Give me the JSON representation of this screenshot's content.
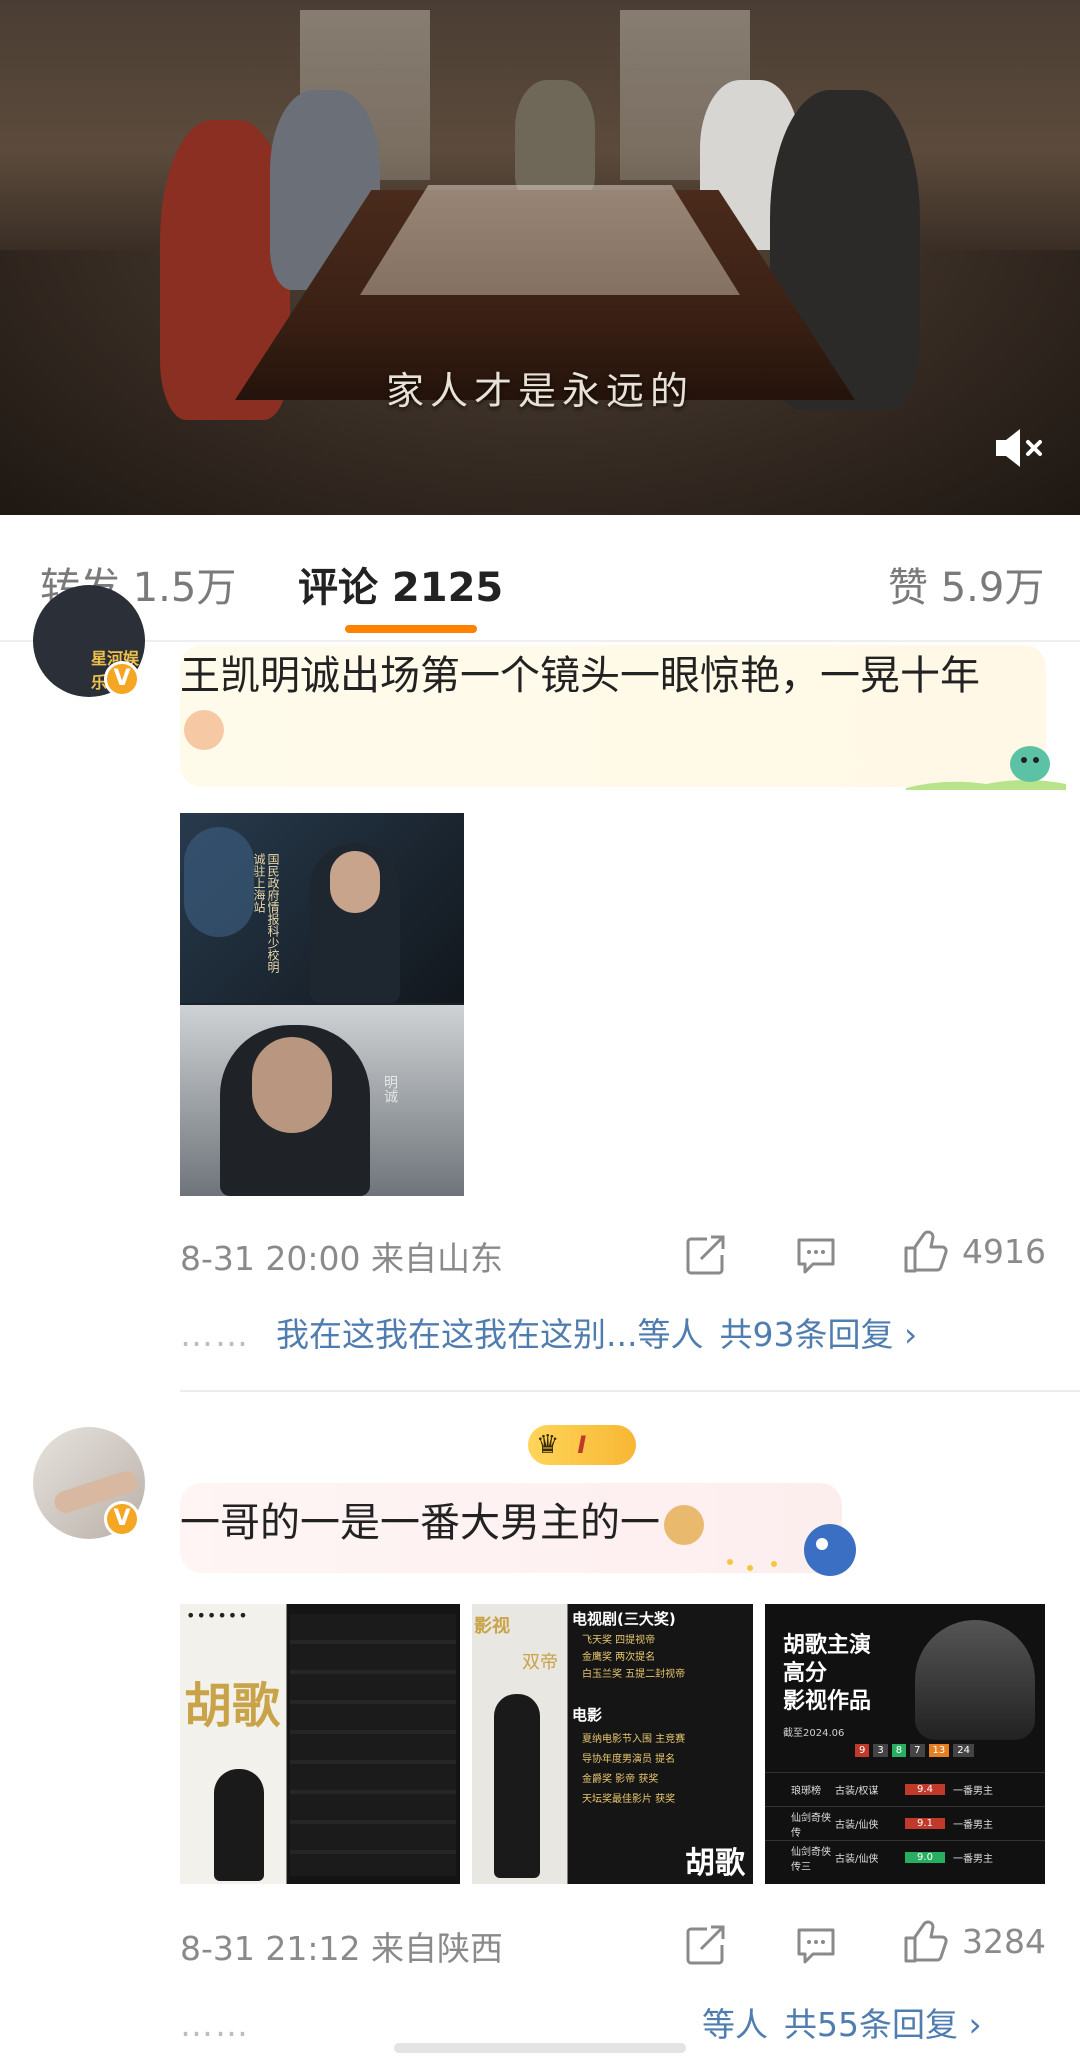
{
  "video": {
    "subtitle": "家人才是永远的",
    "mute_icon": "speaker-muted-icon"
  },
  "tabs": {
    "repost": "转发 1.5万",
    "comments": "评论 2125",
    "likes": "赞 5.9万"
  },
  "comment1": {
    "avatar_label": "星河娱乐",
    "badge": "V",
    "text": "王凯明诚出场第一个镜头一眼惊艳，一晃十年",
    "photo_caption_1": "国民政府情报科少校明诚驻上海站",
    "photo_caption_2": "明诚",
    "time_location": "8-31 20:00 来自山东",
    "like_count": "4916",
    "replies_preview": "我在这我在这我在这别...等人",
    "replies_total": "共93条回复 ›",
    "dots": "……"
  },
  "comment2": {
    "badge": "V",
    "crown_label": "I",
    "text": "一哥的一是一番大男主的一",
    "time_location": "8-31 21:12 来自陕西",
    "like_count": "3284",
    "replies_preview": "等人",
    "replies_total": "共55条回复 ›",
    "dots": "……",
    "photo1": {
      "title": "胡歌",
      "dots": "••••••"
    },
    "photo2": {
      "tag_top": "影视",
      "tag_bottom": "双帝",
      "tv_heading": "电视剧(三大奖)",
      "tv_lines": [
        "飞天奖 四提视帝",
        "金鹰奖 两次提名",
        "白玉兰奖 五提二封视帝"
      ],
      "film_heading": "电影",
      "film_lines": [
        "夏纳电影节入围 主竞赛",
        "导协年度男演员 提名",
        "金爵奖 影帝 获奖",
        "天坛奖最佳影片 获奖"
      ],
      "name": "胡歌"
    },
    "photo3": {
      "title_lines": [
        "胡歌主演",
        "高分",
        "影视作品"
      ],
      "subtitle": "截至2024.06",
      "scores": [
        "9",
        "3",
        "8",
        "7",
        "13",
        "24"
      ],
      "rows": [
        {
          "name": "琅琊榜",
          "genre": "古装/权谋",
          "score": "9.4",
          "role": "一番男主"
        },
        {
          "name": "仙剑奇侠传",
          "genre": "古装/仙侠",
          "score": "9.1",
          "role": "一番男主"
        },
        {
          "name": "仙剑奇侠传三",
          "genre": "古装/仙侠",
          "score": "9.0",
          "role": "一番男主"
        }
      ]
    }
  },
  "colors": {
    "accent": "#ff8200",
    "link": "#507daf",
    "muted": "#8a8a8a",
    "badge": "#f5a623"
  }
}
